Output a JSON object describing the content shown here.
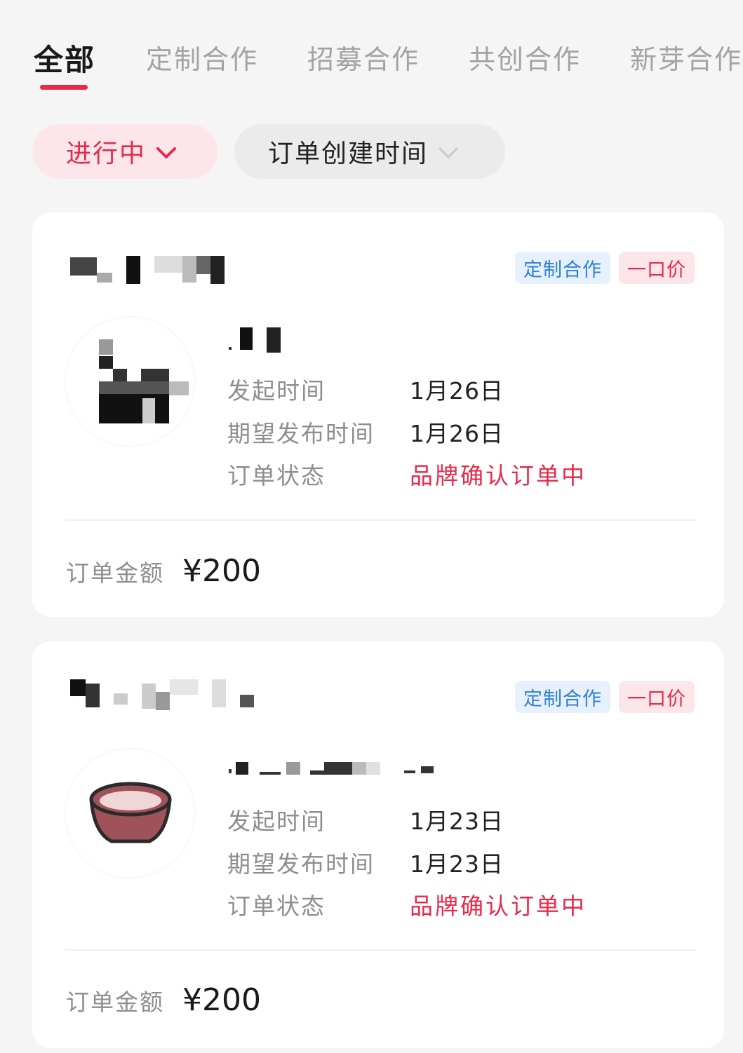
{
  "tabs": [
    "全部",
    "定制合作",
    "招募合作",
    "共创合作",
    "新芽合作"
  ],
  "filters": {
    "status": "进行中",
    "sort": "订单创建时间"
  },
  "labels": {
    "start_time": "发起时间",
    "expected_publish_time": "期望发布时间",
    "order_status": "订单状态",
    "order_amount": "订单金额"
  },
  "orders": [
    {
      "type_badge": "定制合作",
      "price_badge": "一口价",
      "start_time": "1月26日",
      "expected_publish_time": "1月26日",
      "status": "品牌确认订单中",
      "amount": "¥200"
    },
    {
      "type_badge": "定制合作",
      "price_badge": "一口价",
      "start_time": "1月23日",
      "expected_publish_time": "1月23日",
      "status": "品牌确认订单中",
      "amount": "¥200"
    }
  ],
  "colors": {
    "accent": "#e8294a",
    "badge_blue": "#2f7fd6"
  }
}
